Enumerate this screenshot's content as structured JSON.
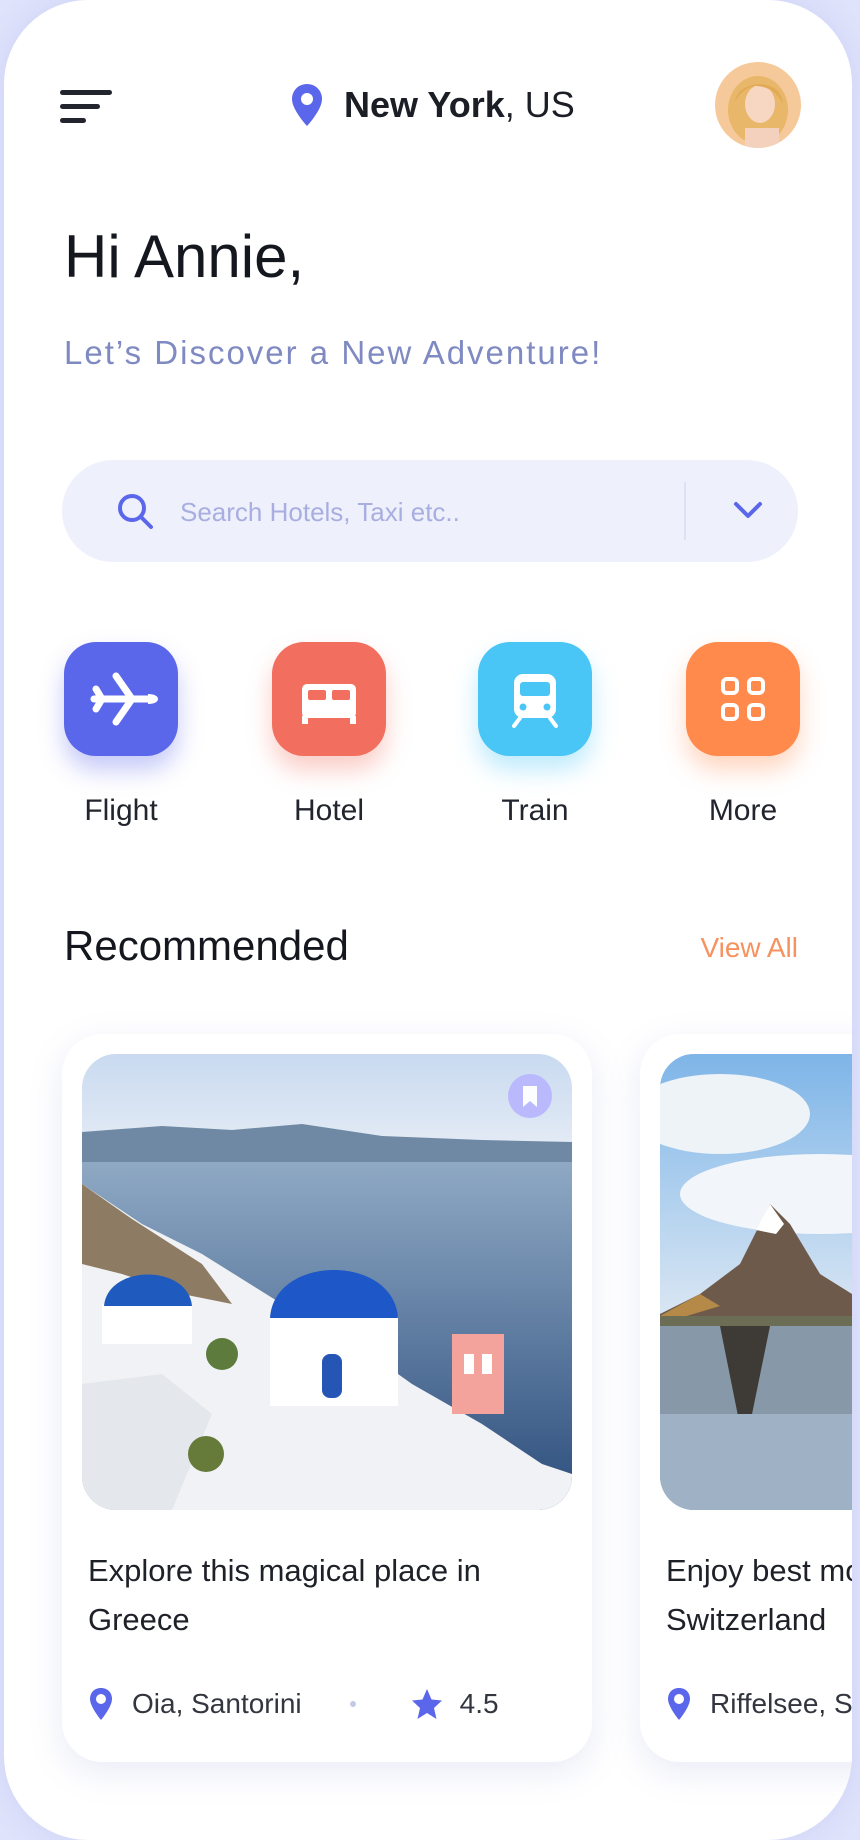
{
  "header": {
    "menu_icon": "hamburger-menu-icon",
    "location_icon": "map-pin-icon",
    "city": "New York",
    "country": ", US",
    "avatar_icon": "user-avatar"
  },
  "greeting": "Hi Annie,",
  "subtitle": "Let’s Discover a New Adventure!",
  "search": {
    "placeholder": "Search Hotels, Taxi etc..",
    "value": "",
    "search_icon": "search-icon",
    "dropdown_icon": "chevron-down-icon"
  },
  "categories": [
    {
      "label": "Flight",
      "icon": "airplane-icon",
      "color": "#5b67ea"
    },
    {
      "label": "Hotel",
      "icon": "bed-icon",
      "color": "#f26f5f"
    },
    {
      "label": "Train",
      "icon": "train-icon",
      "color": "#49c5f6"
    },
    {
      "label": "More",
      "icon": "grid-icon",
      "color": "#ff8a4c"
    }
  ],
  "recommended": {
    "title": "Recommended",
    "view_all": "View All",
    "cards": [
      {
        "title": "Explore this magical place in Greece",
        "location": "Oia, Santorini",
        "rating": "4.5",
        "bookmark_icon": "bookmark-icon",
        "photo": "santorini-photo"
      },
      {
        "title": "Enjoy best moments in Switzerland",
        "location": "Riffelsee, Switzerland",
        "photo": "matterhorn-photo"
      }
    ]
  },
  "colors": {
    "accent": "#5b67ea",
    "subtitle": "#7f8ac2",
    "link": "#f5925f",
    "search_bg": "#eef0fc"
  }
}
